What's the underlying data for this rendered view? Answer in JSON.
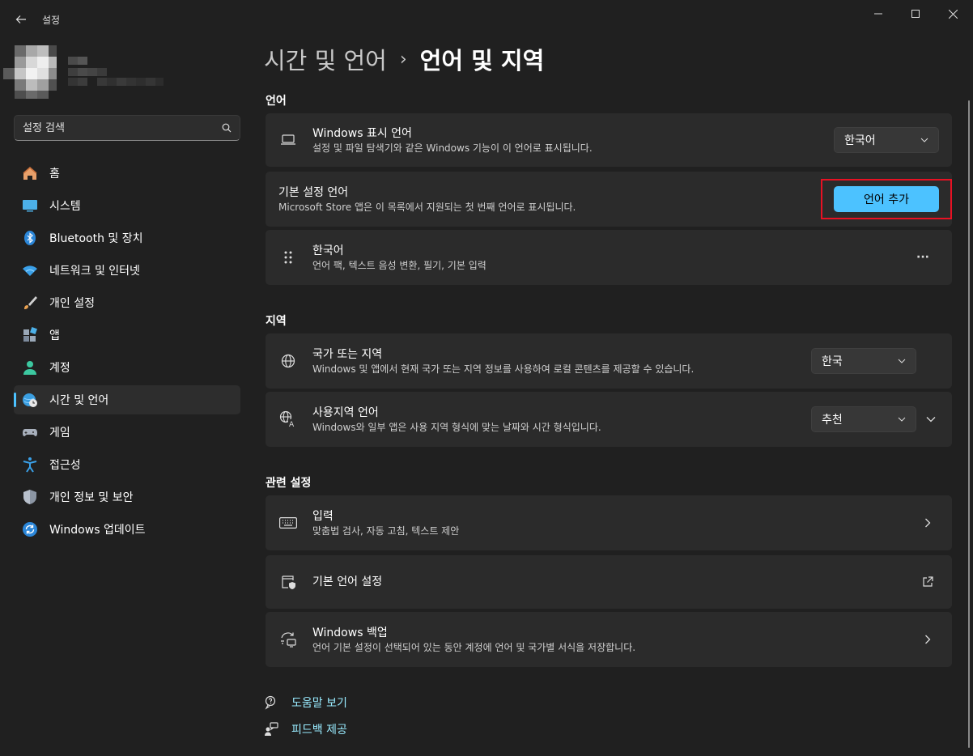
{
  "window": {
    "title": "설정"
  },
  "search": {
    "placeholder": "설정 검색"
  },
  "nav": {
    "items": [
      {
        "label": "홈"
      },
      {
        "label": "시스템"
      },
      {
        "label": "Bluetooth 및 장치"
      },
      {
        "label": "네트워크 및 인터넷"
      },
      {
        "label": "개인 설정"
      },
      {
        "label": "앱"
      },
      {
        "label": "계정"
      },
      {
        "label": "시간 및 언어"
      },
      {
        "label": "게임"
      },
      {
        "label": "접근성"
      },
      {
        "label": "개인 정보 및 보안"
      },
      {
        "label": "Windows 업데이트"
      }
    ],
    "active_index": 7
  },
  "breadcrumb": {
    "parent": "시간 및 언어",
    "separator": "›",
    "current": "언어 및 지역"
  },
  "sections": {
    "language": "언어",
    "region": "지역",
    "related": "관련 설정"
  },
  "language": {
    "display": {
      "title": "Windows 표시 언어",
      "desc": "설정 및 파일 탐색기와 같은 Windows 기능이 이 언어로 표시됩니다.",
      "value": "한국어"
    },
    "preferred": {
      "title": "기본 설정 언어",
      "desc": "Microsoft Store 앱은 이 목록에서 지원되는 첫 번째 언어로 표시됩니다.",
      "button": "언어 추가"
    },
    "installed": {
      "title": "한국어",
      "desc": "언어 팩, 텍스트 음성 변환, 필기, 기본 입력",
      "more": "···"
    }
  },
  "region": {
    "country": {
      "title": "국가 또는 지역",
      "desc": "Windows 및 앱에서 현재 국가 또는 지역 정보를 사용하여 로컬 콘텐츠를 제공할 수 있습니다.",
      "value": "한국"
    },
    "format": {
      "title": "사용지역 언어",
      "desc": "Windows와 일부 앱은 사용 지역 형식에 맞는 날짜와 시간 형식입니다.",
      "value": "추천"
    }
  },
  "related": {
    "input": {
      "title": "입력",
      "desc": "맞춤법 검사, 자동 고침, 텍스트 제안"
    },
    "admin": {
      "title": "기본 언어 설정"
    },
    "backup": {
      "title": "Windows 백업",
      "desc": "언어 기본 설정이 선택되어 있는 동안 계정에 언어 및 국가별 서식을 저장합니다."
    }
  },
  "footer": {
    "help": "도움말 보기",
    "feedback": "피드백 제공"
  },
  "colors": {
    "background": "#202020",
    "card": "#2b2b2b",
    "accent": "#4cc2ff",
    "highlight": "#e81123",
    "link": "#99ebff"
  }
}
